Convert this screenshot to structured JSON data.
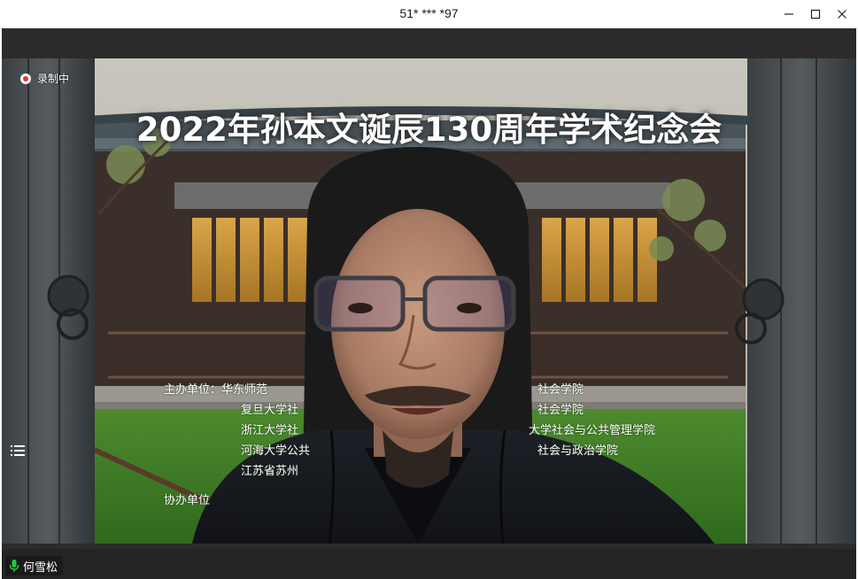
{
  "window": {
    "title": "51* *** *97"
  },
  "recording": {
    "label": "录制中"
  },
  "banner": {
    "title": "2022年孙本文诞辰130周年学术纪念会",
    "organizer_lines_left": [
      "主办单位：华东师范",
      "复旦大学社",
      "浙江大学社",
      "河海大学公共",
      "江苏省苏州",
      "协办单位"
    ],
    "organizer_lines_right": [
      "社会学院",
      "社会学院",
      "大学社会与公共管理学院",
      "社会与政治学院"
    ]
  },
  "participant": {
    "name": "何雪松"
  },
  "colors": {
    "stage_bg": "#2b2b2b",
    "bottom_bar": "#242424",
    "mic_active": "#28c840",
    "rec_dot": "#e5342f"
  }
}
